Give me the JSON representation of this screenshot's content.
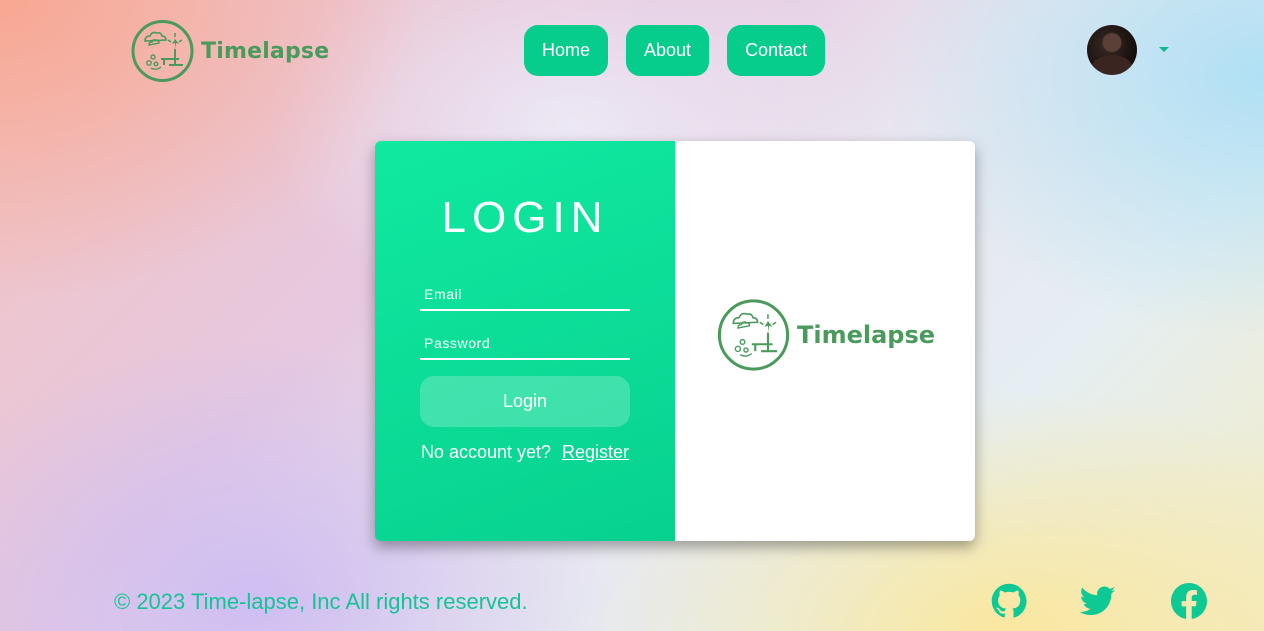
{
  "header": {
    "logo_text": "Timelapse",
    "nav": [
      {
        "label": "Home"
      },
      {
        "label": "About"
      },
      {
        "label": "Contact"
      }
    ]
  },
  "login": {
    "title": "LOGIN",
    "email_placeholder": "Email",
    "password_placeholder": "Password",
    "submit_label": "Login",
    "no_account_text": "No account yet?",
    "register_link": "Register"
  },
  "card_brand": {
    "logo_text": "Timelapse"
  },
  "footer": {
    "copyright": "© 2023 Time-lapse, Inc All rights reserved.",
    "social_icons": [
      "github-icon",
      "twitter-icon",
      "facebook-icon"
    ]
  },
  "colors": {
    "accent": "#06cc8c",
    "brand_green": "#4a9a5c",
    "footer_text": "#14c396"
  }
}
